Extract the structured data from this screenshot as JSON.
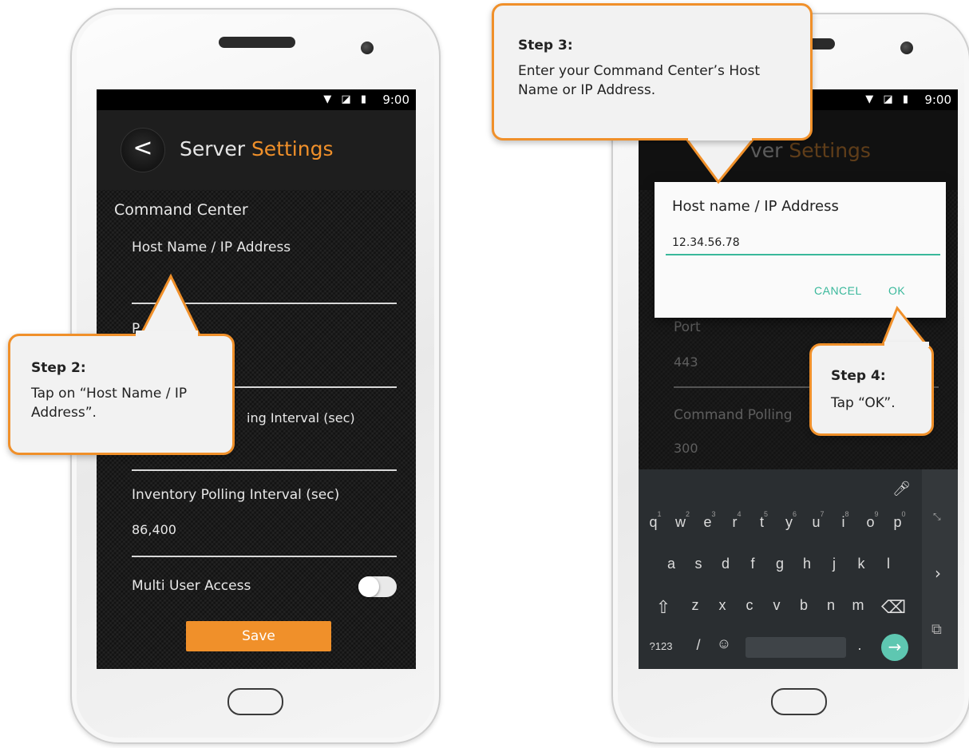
{
  "left_screen": {
    "status": {
      "time": "9:00",
      "icons": "▼ ◪ ▮"
    },
    "app_bar": {
      "back": "<",
      "title_part1": "Server ",
      "title_part2": "Settings"
    },
    "section_title": "Command Center",
    "fields": {
      "host_label": "Host Name / IP Address",
      "port_label_fragment": "P",
      "command_interval_fragment": "ing Interval (sec)",
      "inventory_label": "Inventory Polling Interval (sec)",
      "inventory_value": "86,400",
      "multi_user_label": "Multi User Access"
    },
    "save_label": "Save"
  },
  "right_screen": {
    "status": {
      "time": "9:00",
      "icons": "▼ ◪ ▮"
    },
    "app_bar": {
      "title_part1": "ver ",
      "title_part2": "Settings"
    },
    "dialog": {
      "title": "Host name / IP Address",
      "input_value": "12.34.56.78",
      "cancel": "CANCEL",
      "ok": "OK"
    },
    "background_fields": {
      "port_label": "Port",
      "port_value": "443",
      "command_label": "Command Polling",
      "command_value": "300"
    },
    "keyboard": {
      "row1": [
        "q",
        "w",
        "e",
        "r",
        "t",
        "y",
        "u",
        "i",
        "o",
        "p"
      ],
      "row1_hints": [
        "1",
        "2",
        "3",
        "4",
        "5",
        "6",
        "7",
        "8",
        "9",
        "0"
      ],
      "row2": [
        "a",
        "s",
        "d",
        "f",
        "g",
        "h",
        "j",
        "k",
        "l"
      ],
      "row3": [
        "z",
        "x",
        "c",
        "v",
        "b",
        "n",
        "m"
      ],
      "symbols": "?123",
      "slash": "/",
      "period": "."
    }
  },
  "callouts": {
    "step2": {
      "title": "Step 2:",
      "text": "Tap on “Host Name / IP Address”."
    },
    "step3": {
      "title": "Step 3:",
      "text": "Enter your Command Center’s Host Name or IP Address."
    },
    "step4": {
      "title": "Step 4:",
      "text": "Tap “OK”."
    }
  },
  "colors": {
    "accent": "#f0902a",
    "dialog_accent": "#39b89b",
    "keyboard_bg": "#2a2e31"
  }
}
